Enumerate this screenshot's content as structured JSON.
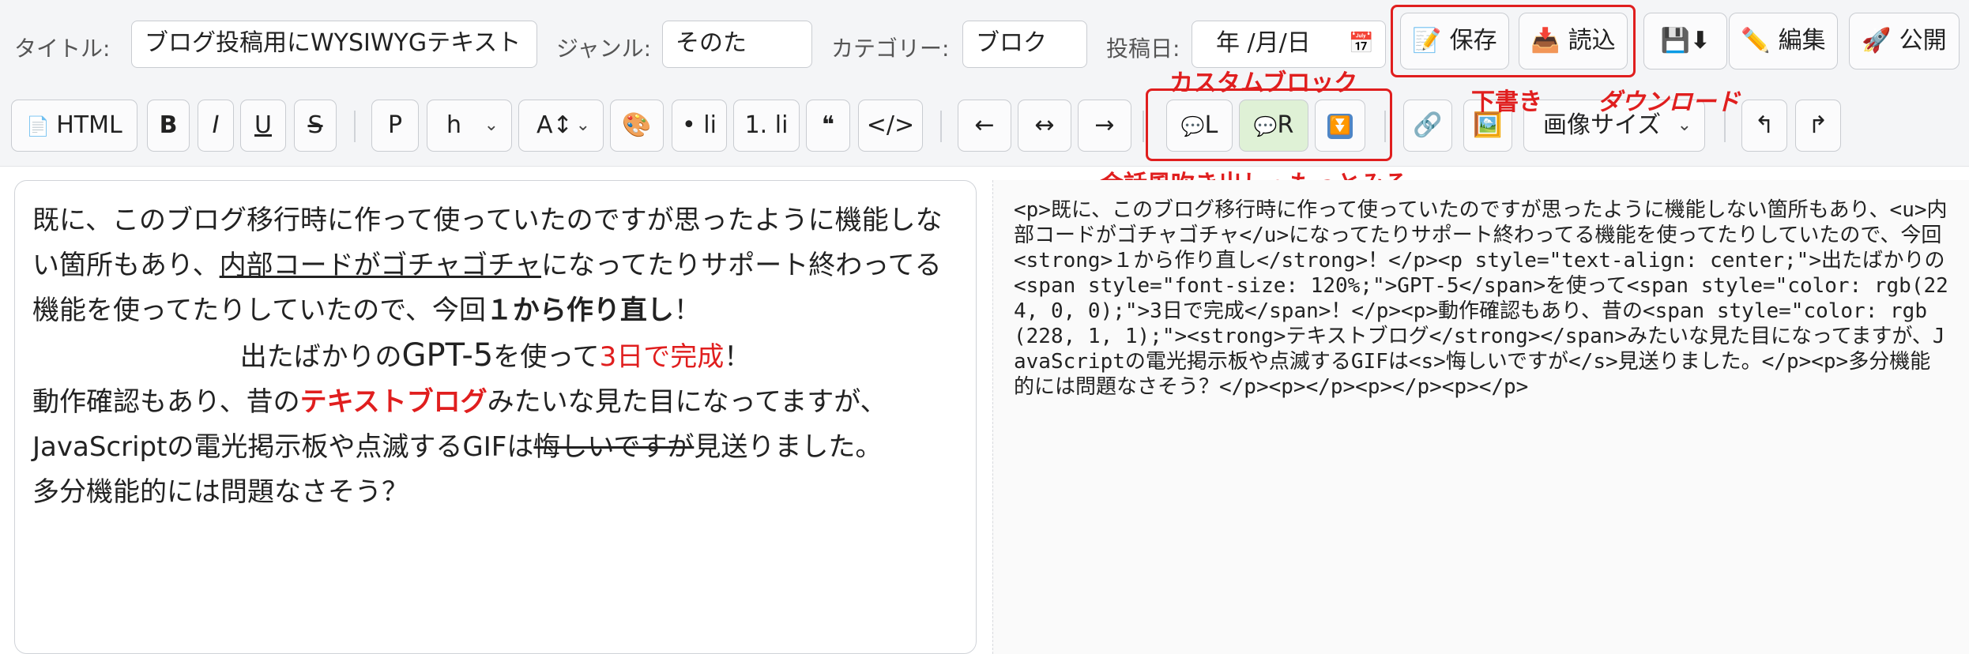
{
  "header": {
    "title_label": "タイトル:",
    "title_value": "ブログ投稿用にWYSIWYGテキスト",
    "genre_label": "ジャンル:",
    "genre_value": "そのた",
    "category_label": "カテゴリー:",
    "category_value": "ブロク",
    "date_label": "投稿日:",
    "date_value": "年 /月/日",
    "buttons": {
      "save": "保存",
      "load": "読込",
      "download": "⬇",
      "edit": "編集",
      "publish": "公開"
    }
  },
  "toolbar": {
    "html": "HTML",
    "bold": "B",
    "italic": "I",
    "underline": "U",
    "strike": "S",
    "paragraph": "P",
    "heading": "h",
    "font_size": "A↕",
    "bullet_list": "• li",
    "number_list": "1. li",
    "quote": "❝",
    "code": "</>",
    "align_left": "←",
    "align_center": "↔",
    "align_right": "→",
    "speech_left": "L",
    "speech_right": "R",
    "image_size": "画像サイズ",
    "undo": "↰",
    "redo": "↱"
  },
  "annotations": {
    "custom_block": "カスタムブロック",
    "draft": "下書き",
    "download": "ダウンロード",
    "speech_more": "会話風吹き出し・もっとみる"
  },
  "editor": {
    "p1_a": "既に、このブログ移行時に作って使っていたのですが思ったように機能しない箇所もあり、",
    "p1_u": "内部コードがゴチャゴチャ",
    "p1_b": "になってたりサポート終わってる機能を使ってたりしていたので、今回",
    "p1_strong": "１から作り直し",
    "p1_c": "！",
    "p2_a": "出たばかりの",
    "p2_big": "GPT-5",
    "p2_b": "を使って",
    "p2_red": "3日で完成",
    "p2_c": "！",
    "p3_a": "動作確認もあり、昔の",
    "p3_strong": "テキストブログ",
    "p3_b": "みたいな見た目になってますが、JavaScriptの電光掲示板や点滅するGIFは",
    "p3_s": "悔しいですが",
    "p3_c": "見送りました。",
    "p4": "多分機能的には問題なさそう？"
  },
  "source": {
    "html": "<p>既に、このブログ移行時に作って使っていたのですが思ったように機能しない箇所もあり、<u>内部コードがゴチャゴチャ</u>になってたりサポート終わってる機能を使ってたりしていたので、今回<strong>１から作り直し</strong>！</p><p style=\"text-align: center;\">出たばかりの<span style=\"font-size: 120%;\">GPT-5</span>を使って<span style=\"color: rgb(224, 0, 0);\">3日で完成</span>！</p><p>動作確認もあり、昔の<span style=\"color: rgb(228, 1, 1);\"><strong>テキストブログ</strong></span>みたいな見た目になってますが、JavaScriptの電光掲示板や点滅するGIFは<s>悔しいですが</s>見送りました。</p><p>多分機能的には問題なさそう？</p><p></p><p></p><p></p>"
  },
  "colors": {
    "annotation_red": "#e01e1e",
    "green_button": "#dff1d6",
    "text_red": "#e01e1e"
  }
}
